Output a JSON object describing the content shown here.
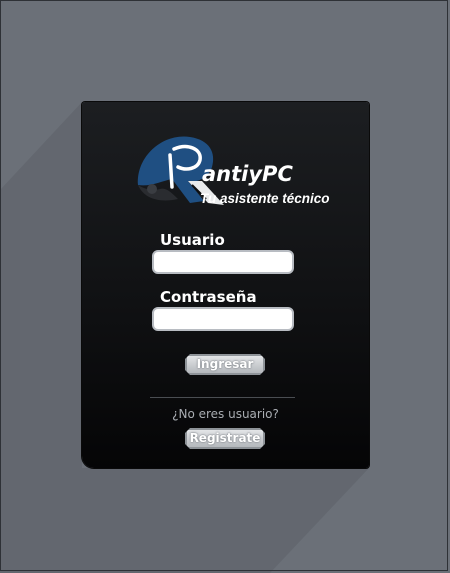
{
  "brand": {
    "name": "antiyPC",
    "tagline": "Tu asistente técnico",
    "logo_icon": "stylized-r-logo-icon",
    "colors": {
      "accent": "#1f4f82",
      "card": "#111214",
      "background": "#6b7078"
    }
  },
  "form": {
    "username_label": "Usuario",
    "username_value": "",
    "password_label": "Contraseña",
    "password_value": "",
    "login_label": "Ingresar"
  },
  "signup": {
    "prompt": "¿No eres usuario?",
    "register_label": "Registrate"
  }
}
